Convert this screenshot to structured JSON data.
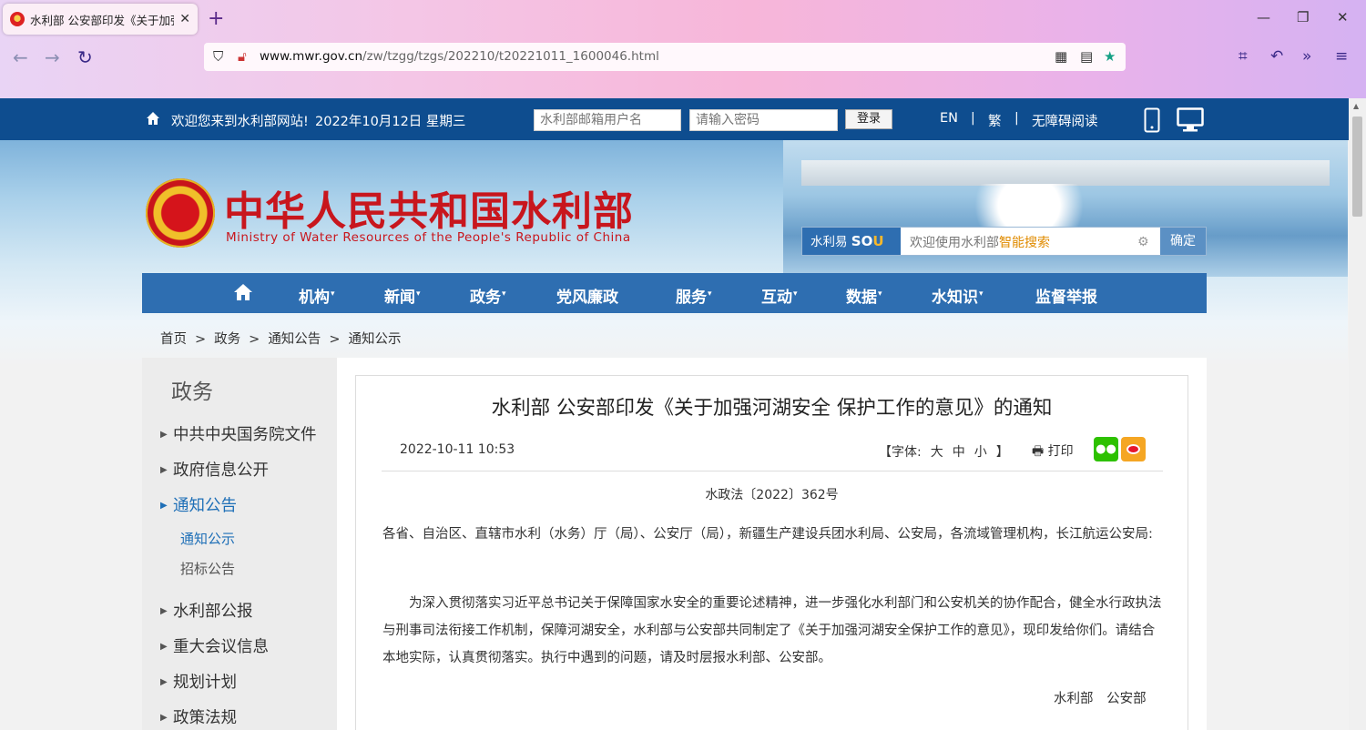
{
  "browser": {
    "tab_title": "水利部 公安部印发《关于加强河...",
    "url_host": "www.mwr.gov.cn",
    "url_path": "/zw/tzgg/tzgs/202210/t20221011_1600046.html"
  },
  "topbar": {
    "welcome": "欢迎您来到水利部网站!",
    "date": "2022年10月12日 星期三",
    "username_placeholder": "水利部邮箱用户名",
    "password_placeholder": "请输入密码",
    "login_label": "登录",
    "lang_en": "EN",
    "lang_traditional": "繁",
    "accessibility": "无障碍阅读"
  },
  "header": {
    "title_cn": "中华人民共和国水利部",
    "title_en": "Ministry of Water Resources of the People's Republic of China"
  },
  "search": {
    "brand_text": "水利易",
    "brand_logo": "SO",
    "brand_logo_tail": "U",
    "placeholder_pre": "欢迎使用水利部",
    "placeholder_hl": "智能搜索",
    "submit_label": "确定"
  },
  "nav": {
    "items": [
      {
        "label": "机构",
        "dropdown": "▾"
      },
      {
        "label": "新闻",
        "dropdown": "▾"
      },
      {
        "label": "政务",
        "dropdown": "▾"
      },
      {
        "label": "党风廉政",
        "dropdown": ""
      },
      {
        "label": "服务",
        "dropdown": "▾"
      },
      {
        "label": "互动",
        "dropdown": "▾"
      },
      {
        "label": "数据",
        "dropdown": "▾"
      },
      {
        "label": "水知识",
        "dropdown": "▾"
      },
      {
        "label": "监督举报",
        "dropdown": ""
      }
    ]
  },
  "breadcrumb": {
    "items": [
      "首页",
      "政务",
      "通知公告",
      "通知公示"
    ],
    "separator": ">"
  },
  "sidebar": {
    "title": "政务",
    "items": [
      {
        "label": "中共中央国务院文件"
      },
      {
        "label": "政府信息公开"
      },
      {
        "label": "通知公告"
      },
      {
        "label": "水利部公报"
      },
      {
        "label": "重大会议信息"
      },
      {
        "label": "规划计划"
      },
      {
        "label": "政策法规"
      }
    ],
    "subitems": [
      {
        "label": "通知公示"
      },
      {
        "label": "招标公告"
      }
    ]
  },
  "article": {
    "title": "水利部 公安部印发《关于加强河湖安全 保护工作的意见》的通知",
    "datetime": "2022-10-11 10:53",
    "font_label": "【字体:",
    "font_large": "大",
    "font_medium": "中",
    "font_small": "小",
    "font_close": "】",
    "print_label": "打印",
    "doc_number": "水政法〔2022〕362号",
    "paragraph1": "各省、自治区、直辖市水利（水务）厅（局）、公安厅（局），新疆生产建设兵团水利局、公安局，各流域管理机构，长江航运公安局:",
    "paragraph2": "为深入贯彻落实习近平总书记关于保障国家水安全的重要论述精神，进一步强化水利部门和公安机关的协作配合，健全水行政执法与刑事司法衔接工作机制，保障河湖安全，水利部与公安部共同制定了《关于加强河湖安全保护工作的意见》，现印发给你们。请结合本地实际，认真贯彻落实。执行中遇到的问题，请及时层报水利部、公安部。",
    "signature": "水利部 公安部"
  },
  "colors": {
    "topbar": "#0e4d8f",
    "nav": "#2e6eb1",
    "title_red": "#c8161d",
    "active_blue": "#1e6fb7"
  }
}
